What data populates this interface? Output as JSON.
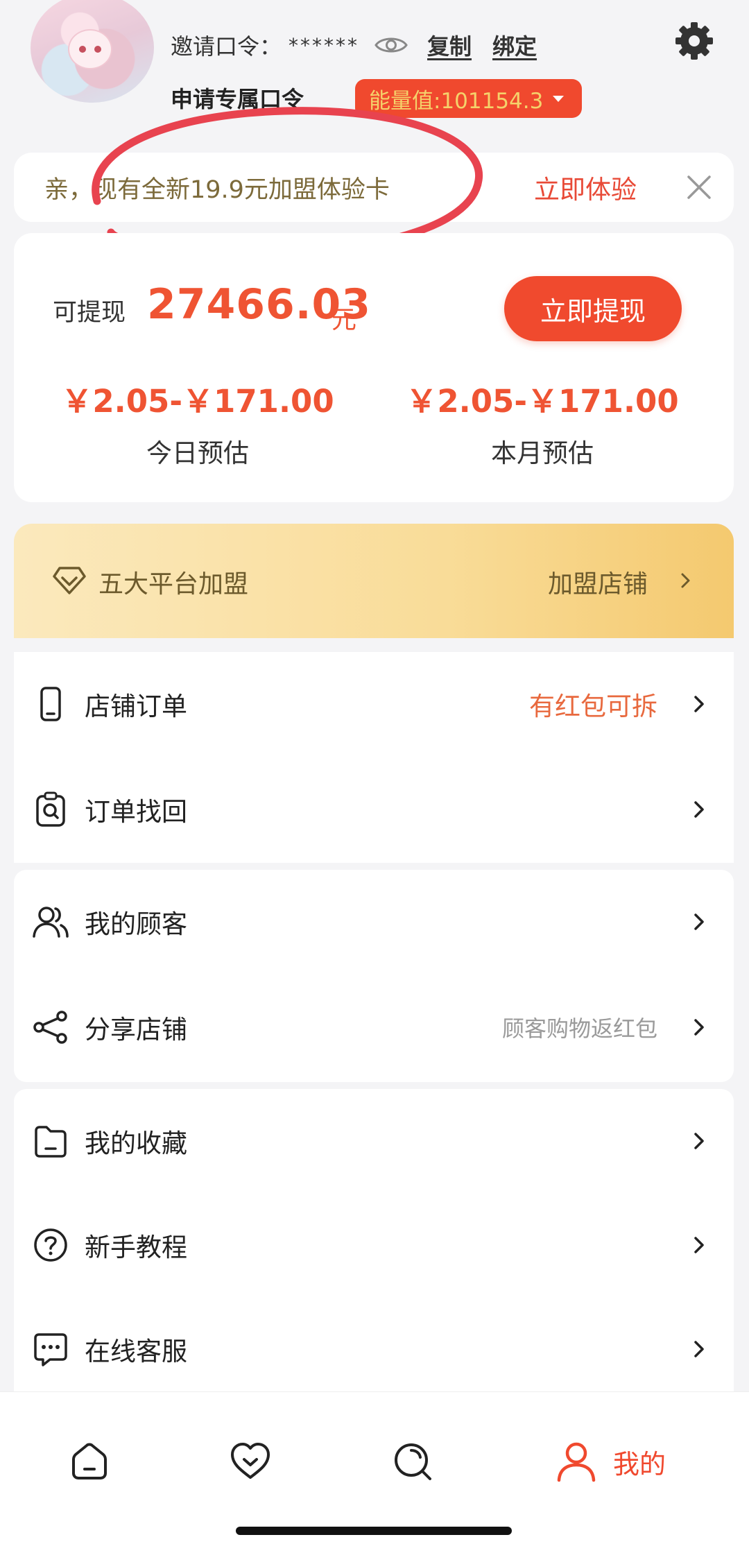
{
  "header": {
    "invite_label": "邀请口令：",
    "invite_code": "******",
    "copy_label": "复制",
    "bind_label": "绑定",
    "apply_label": "申请专属口令",
    "energy_label": "能量值:101154.3"
  },
  "promo": {
    "text": "亲，现有全新19.9元加盟体验卡",
    "cta": "立即体验"
  },
  "balance": {
    "withdraw_label": "可提现",
    "amount": "27466.03",
    "unit": "元",
    "withdraw_button": "立即提现",
    "today_range": "￥2.05-￥171.00",
    "today_label": "今日预估",
    "month_range": "￥2.05-￥171.00",
    "month_label": "本月预估"
  },
  "franchise": {
    "title": "五大平台加盟",
    "link": "加盟店铺"
  },
  "menu": {
    "store_orders": {
      "label": "店铺订单",
      "hint": "有红包可拆"
    },
    "order_recovery": {
      "label": "订单找回"
    },
    "my_customers": {
      "label": "我的顾客"
    },
    "share_store": {
      "label": "分享店铺",
      "hint": "顾客购物返红包"
    },
    "my_favorites": {
      "label": "我的收藏"
    },
    "tutorial": {
      "label": "新手教程"
    },
    "customer_service": {
      "label": "在线客服"
    }
  },
  "tabbar": {
    "me_label": "我的"
  },
  "colors": {
    "accent": "#f0492e",
    "gold": "#f5d26b"
  }
}
